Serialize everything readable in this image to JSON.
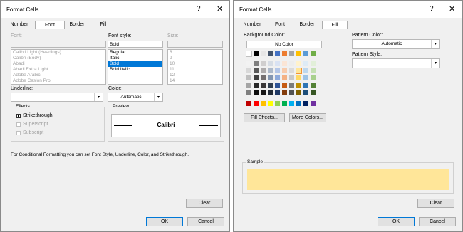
{
  "left": {
    "title": "Format Cells",
    "help": "?",
    "close": "✕",
    "tabs": [
      "Number",
      "Font",
      "Border",
      "Fill"
    ],
    "font_label": "Font:",
    "font_style_label": "Font style:",
    "size_label": "Size:",
    "font_style_value": "Bold",
    "fonts": [
      "Calibri Light (Headings)",
      "Calibri (Body)",
      "Abadi",
      "Abadi Extra Light",
      "Adobe Arabic",
      "Adobe Caslon Pro"
    ],
    "styles": [
      "Regular",
      "Italic",
      "Bold",
      "Bold Italic"
    ],
    "sizes": [
      "8",
      "9",
      "10",
      "11",
      "12",
      "14"
    ],
    "underline_label": "Underline:",
    "color_label": "Color:",
    "color_value": "Automatic",
    "effects_title": "Effects",
    "effects": [
      "Strikethrough",
      "Superscript",
      "Subscript"
    ],
    "preview_title": "Preview",
    "preview_text": "Calibri",
    "info_text": "For Conditional Formatting you can set Font Style, Underline, Color, and Strikethrough.",
    "clear": "Clear",
    "ok": "OK",
    "cancel": "Cancel"
  },
  "right": {
    "title": "Format Cells",
    "help": "?",
    "close": "✕",
    "tabs": [
      "Number",
      "Font",
      "Border",
      "Fill"
    ],
    "bg_color_label": "Background Color:",
    "no_color": "No Color",
    "pattern_color_label": "Pattern Color:",
    "pattern_color_value": "Automatic",
    "pattern_style_label": "Pattern Style:",
    "fill_effects": "Fill Effects...",
    "more_colors": "More Colors...",
    "sample_label": "Sample",
    "sample_color": "#ffe699",
    "clear": "Clear",
    "ok": "OK",
    "cancel": "Cancel",
    "theme_colors": [
      [
        "#ffffff",
        "#000000",
        "#e7e6e6",
        "#44546a",
        "#4472c4",
        "#ed7d31",
        "#a5a5a5",
        "#ffc000",
        "#5b9bd5",
        "#70ad47"
      ],
      [
        "#f2f2f2",
        "#7f7f7f",
        "#d0cece",
        "#d6dce4",
        "#d9e2f3",
        "#fbe5d5",
        "#ededed",
        "#fff2cc",
        "#deebf6",
        "#e2efd9"
      ],
      [
        "#d8d8d8",
        "#595959",
        "#aeabab",
        "#adb9ca",
        "#b4c6e7",
        "#f7cbac",
        "#dbdbdb",
        "#ffe699",
        "#bdd7ee",
        "#c5e0b3"
      ],
      [
        "#bfbfbf",
        "#3f3f3f",
        "#757070",
        "#8496b0",
        "#8eaadb",
        "#f4b183",
        "#c9c9c9",
        "#ffd965",
        "#9dc3e6",
        "#a8d08d"
      ],
      [
        "#a5a5a5",
        "#262626",
        "#3a3838",
        "#323f4f",
        "#2f5496",
        "#c55a11",
        "#7b7b7b",
        "#bf9000",
        "#2e75b5",
        "#538135"
      ],
      [
        "#7f7f7f",
        "#0c0c0c",
        "#171616",
        "#222a35",
        "#1f3864",
        "#833c0b",
        "#525252",
        "#7f6000",
        "#1e4e79",
        "#375623"
      ]
    ],
    "standard_colors": [
      "#c00000",
      "#ff0000",
      "#ffc000",
      "#ffff00",
      "#92d050",
      "#00b050",
      "#00b0f0",
      "#0070c0",
      "#002060",
      "#7030a0"
    ]
  }
}
